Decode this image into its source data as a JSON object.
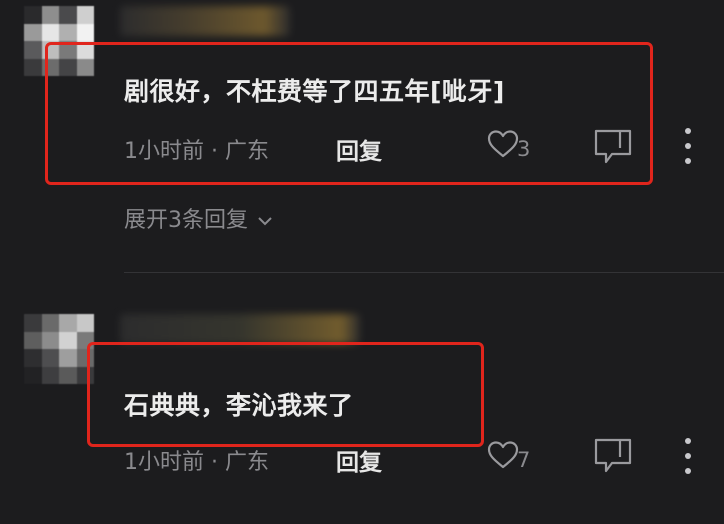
{
  "comments": [
    {
      "text": "剧很好，不枉费等了四五年[呲牙]",
      "time": "1小时前",
      "location": "广东",
      "reply_label": "回复",
      "like_count": "3",
      "expand_label": "展开3条回复"
    },
    {
      "text": "石典典，李沁我来了",
      "time": "1小时前",
      "location": "广东",
      "reply_label": "回复",
      "like_count": "7"
    }
  ],
  "meta_separator": " · ",
  "colors": {
    "background": "#1c1c1e",
    "highlight_box": "#e0251c",
    "secondary_text": "#8a8a8e",
    "primary_text": "#ececec"
  },
  "icons": {
    "like": "heart-outline-icon",
    "dislike": "thumb-down-bubble-icon",
    "more": "vertical-ellipsis-icon",
    "expand": "chevron-down-icon"
  }
}
